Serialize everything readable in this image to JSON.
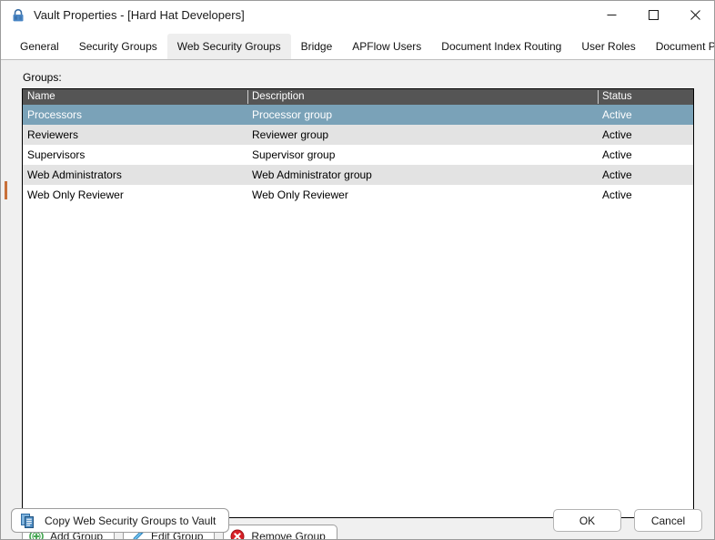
{
  "window": {
    "title": "Vault Properties - [Hard Hat Developers]",
    "icon": "lock-icon",
    "controls": {
      "minimize": "minimize-icon",
      "maximize": "maximize-icon",
      "close": "close-icon"
    }
  },
  "tabs": [
    {
      "label": "General",
      "selected": false
    },
    {
      "label": "Security Groups",
      "selected": false
    },
    {
      "label": "Web Security Groups",
      "selected": true
    },
    {
      "label": "Bridge",
      "selected": false
    },
    {
      "label": "APFlow Users",
      "selected": false
    },
    {
      "label": "Document Index Routing",
      "selected": false
    },
    {
      "label": "User Roles",
      "selected": false
    },
    {
      "label": "Document Publishing",
      "selected": false
    }
  ],
  "main": {
    "groups_label": "Groups:",
    "columns": [
      "Name",
      "Description",
      "Status"
    ],
    "rows": [
      {
        "name": "Processors",
        "description": "Processor group",
        "status": "Active",
        "selected": true
      },
      {
        "name": "Reviewers",
        "description": "Reviewer group",
        "status": "Active",
        "selected": false
      },
      {
        "name": "Supervisors",
        "description": "Supervisor group",
        "status": "Active",
        "selected": false
      },
      {
        "name": "Web Administrators",
        "description": "Web Administrator group",
        "status": "Active",
        "selected": false
      },
      {
        "name": "Web Only Reviewer",
        "description": "Web Only Reviewer",
        "status": "Active",
        "selected": false
      }
    ]
  },
  "actions": {
    "add_group": "Add Group",
    "edit_group": "Edit Group",
    "remove_group": "Remove Group",
    "add_icon": "plus-circle-icon",
    "edit_icon": "pencil-icon",
    "remove_icon": "delete-circle-icon"
  },
  "footer": {
    "copy_label": "Copy Web Security Groups to Vault",
    "copy_icon": "copy-documents-icon",
    "ok_label": "OK",
    "cancel_label": "Cancel"
  },
  "colors": {
    "selection_blue": "#7aa2b8",
    "header_gray": "#555555",
    "alt_row_gray": "#e3e3e3",
    "dialog_bg": "#f0f0f0",
    "add_green": "#3fa34d",
    "edit_blue": "#4a9fd8",
    "remove_red": "#d81f26",
    "copy_blue": "#2e6ca4"
  }
}
